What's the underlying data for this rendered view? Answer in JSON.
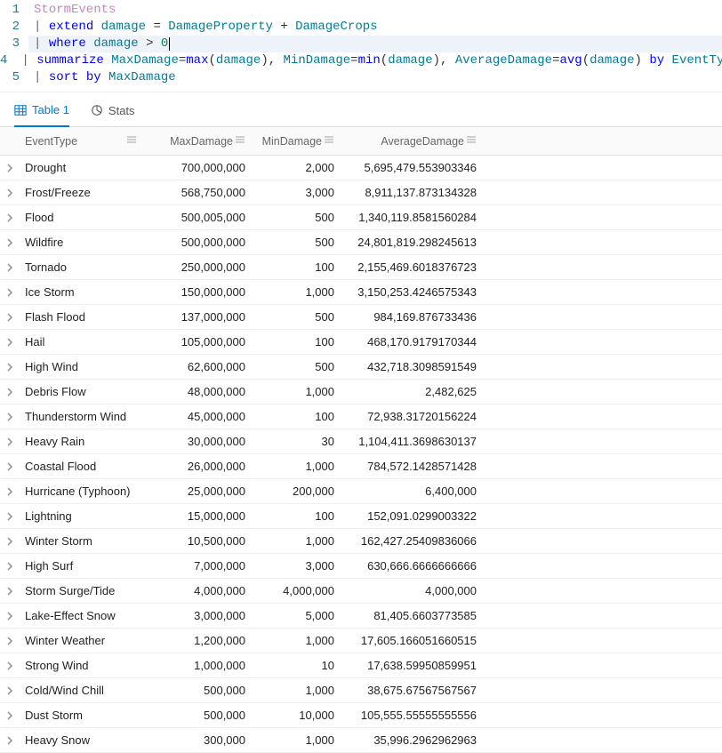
{
  "editor": {
    "lines": [
      {
        "n": "1",
        "hl": false,
        "tokens": [
          [
            "tbl",
            "StormEvents"
          ]
        ]
      },
      {
        "n": "2",
        "hl": false,
        "tokens": [
          [
            "pipe",
            "| "
          ],
          [
            "kw",
            "extend"
          ],
          [
            "txt",
            " "
          ],
          [
            "fld",
            "damage"
          ],
          [
            "txt",
            " "
          ],
          [
            "op",
            "="
          ],
          [
            "txt",
            " "
          ],
          [
            "fld",
            "DamageProperty"
          ],
          [
            "txt",
            " "
          ],
          [
            "op",
            "+"
          ],
          [
            "txt",
            " "
          ],
          [
            "fld",
            "DamageCrops"
          ]
        ]
      },
      {
        "n": "3",
        "hl": true,
        "tokens": [
          [
            "pipe",
            "| "
          ],
          [
            "kw",
            "where"
          ],
          [
            "txt",
            " "
          ],
          [
            "fld",
            "damage"
          ],
          [
            "txt",
            " "
          ],
          [
            "op",
            ">"
          ],
          [
            "txt",
            " "
          ],
          [
            "num2",
            "0"
          ],
          [
            "cursor",
            ""
          ]
        ]
      },
      {
        "n": "4",
        "hl": false,
        "tokens": [
          [
            "pipe",
            "| "
          ],
          [
            "kw",
            "summarize"
          ],
          [
            "txt",
            " "
          ],
          [
            "fld",
            "MaxDamage"
          ],
          [
            "op",
            "="
          ],
          [
            "fn",
            "max"
          ],
          [
            "op",
            "("
          ],
          [
            "fld",
            "damage"
          ],
          [
            "op",
            "),"
          ],
          [
            "txt",
            " "
          ],
          [
            "fld",
            "MinDamage"
          ],
          [
            "op",
            "="
          ],
          [
            "fn",
            "min"
          ],
          [
            "op",
            "("
          ],
          [
            "fld",
            "damage"
          ],
          [
            "op",
            "),"
          ],
          [
            "txt",
            " "
          ],
          [
            "fld",
            "AverageDamage"
          ],
          [
            "op",
            "="
          ],
          [
            "fn",
            "avg"
          ],
          [
            "op",
            "("
          ],
          [
            "fld",
            "damage"
          ],
          [
            "op",
            ")"
          ],
          [
            "txt",
            " "
          ],
          [
            "kw",
            "by"
          ],
          [
            "txt",
            " "
          ],
          [
            "fld",
            "EventType"
          ]
        ]
      },
      {
        "n": "5",
        "hl": false,
        "tokens": [
          [
            "pipe",
            "| "
          ],
          [
            "kw",
            "sort"
          ],
          [
            "txt",
            " "
          ],
          [
            "kw",
            "by"
          ],
          [
            "txt",
            " "
          ],
          [
            "fld",
            "MaxDamage"
          ]
        ]
      }
    ]
  },
  "tabs": {
    "table": "Table 1",
    "stats": "Stats"
  },
  "columns": {
    "event": "EventType",
    "max": "MaxDamage",
    "min": "MinDamage",
    "avg": "AverageDamage"
  },
  "rows": [
    {
      "event": "Drought",
      "max": "700,000,000",
      "min": "2,000",
      "avg": "5,695,479.553903346"
    },
    {
      "event": "Frost/Freeze",
      "max": "568,750,000",
      "min": "3,000",
      "avg": "8,911,137.873134328"
    },
    {
      "event": "Flood",
      "max": "500,005,000",
      "min": "500",
      "avg": "1,340,119.8581560284"
    },
    {
      "event": "Wildfire",
      "max": "500,000,000",
      "min": "500",
      "avg": "24,801,819.298245613"
    },
    {
      "event": "Tornado",
      "max": "250,000,000",
      "min": "100",
      "avg": "2,155,469.6018376723"
    },
    {
      "event": "Ice Storm",
      "max": "150,000,000",
      "min": "1,000",
      "avg": "3,150,253.4246575343"
    },
    {
      "event": "Flash Flood",
      "max": "137,000,000",
      "min": "500",
      "avg": "984,169.876733436"
    },
    {
      "event": "Hail",
      "max": "105,000,000",
      "min": "100",
      "avg": "468,170.9179170344"
    },
    {
      "event": "High Wind",
      "max": "62,600,000",
      "min": "500",
      "avg": "432,718.3098591549"
    },
    {
      "event": "Debris Flow",
      "max": "48,000,000",
      "min": "1,000",
      "avg": "2,482,625"
    },
    {
      "event": "Thunderstorm Wind",
      "max": "45,000,000",
      "min": "100",
      "avg": "72,938.31720156224"
    },
    {
      "event": "Heavy Rain",
      "max": "30,000,000",
      "min": "30",
      "avg": "1,104,411.3698630137"
    },
    {
      "event": "Coastal Flood",
      "max": "26,000,000",
      "min": "1,000",
      "avg": "784,572.1428571428"
    },
    {
      "event": "Hurricane (Typhoon)",
      "max": "25,000,000",
      "min": "200,000",
      "avg": "6,400,000"
    },
    {
      "event": "Lightning",
      "max": "15,000,000",
      "min": "100",
      "avg": "152,091.0299003322"
    },
    {
      "event": "Winter Storm",
      "max": "10,500,000",
      "min": "1,000",
      "avg": "162,427.25409836066"
    },
    {
      "event": "High Surf",
      "max": "7,000,000",
      "min": "3,000",
      "avg": "630,666.6666666666"
    },
    {
      "event": "Storm Surge/Tide",
      "max": "4,000,000",
      "min": "4,000,000",
      "avg": "4,000,000"
    },
    {
      "event": "Lake-Effect Snow",
      "max": "3,000,000",
      "min": "5,000",
      "avg": "81,405.6603773585"
    },
    {
      "event": "Winter Weather",
      "max": "1,200,000",
      "min": "1,000",
      "avg": "17,605.166051660515"
    },
    {
      "event": "Strong Wind",
      "max": "1,000,000",
      "min": "10",
      "avg": "17,638.59950859951"
    },
    {
      "event": "Cold/Wind Chill",
      "max": "500,000",
      "min": "1,000",
      "avg": "38,675.67567567567"
    },
    {
      "event": "Dust Storm",
      "max": "500,000",
      "min": "10,000",
      "avg": "105,555.55555555556"
    },
    {
      "event": "Heavy Snow",
      "max": "300,000",
      "min": "1,000",
      "avg": "35,996.2962962963"
    }
  ]
}
